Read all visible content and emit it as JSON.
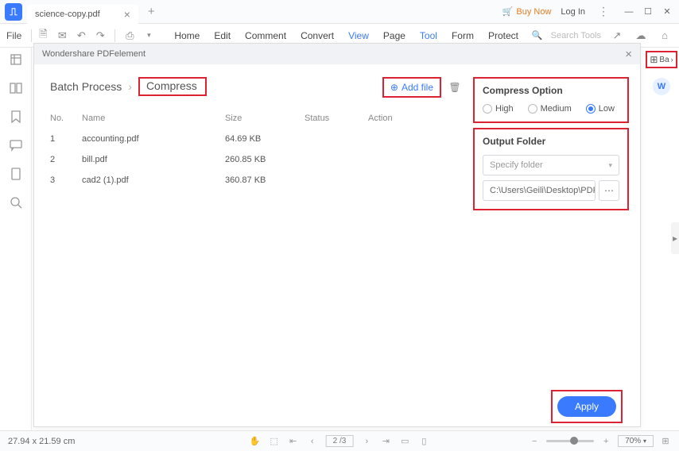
{
  "titlebar": {
    "filename": "science-copy.pdf",
    "buynow": "Buy Now",
    "login": "Log In"
  },
  "menubar": {
    "file": "File",
    "items": [
      "Home",
      "Edit",
      "Comment",
      "Convert",
      "View",
      "Page",
      "Tool",
      "Form",
      "Protect"
    ],
    "active_index": 6,
    "search_placeholder": "Search Tools"
  },
  "dialog": {
    "title": "Wondershare PDFelement",
    "breadcrumb_root": "Batch Process",
    "breadcrumb_current": "Compress",
    "addfile": "Add file",
    "columns": {
      "no": "No.",
      "name": "Name",
      "size": "Size",
      "status": "Status",
      "action": "Action"
    },
    "rows": [
      {
        "no": "1",
        "name": "accounting.pdf",
        "size": "64.69 KB"
      },
      {
        "no": "2",
        "name": "bill.pdf",
        "size": "260.85 KB"
      },
      {
        "no": "3",
        "name": "cad2 (1).pdf",
        "size": "360.87 KB"
      }
    ],
    "compress_option": {
      "title": "Compress Option",
      "high": "High",
      "medium": "Medium",
      "low": "Low",
      "selected": "low"
    },
    "output": {
      "title": "Output Folder",
      "placeholder": "Specify folder",
      "path": "C:\\Users\\Geili\\Desktop\\PDFelement\\Op"
    },
    "apply": "Apply"
  },
  "rightbar": {
    "batch": "Ba"
  },
  "statusbar": {
    "dims": "27.94 x 21.59 cm",
    "page": "2 /3",
    "zoom": "70%"
  }
}
